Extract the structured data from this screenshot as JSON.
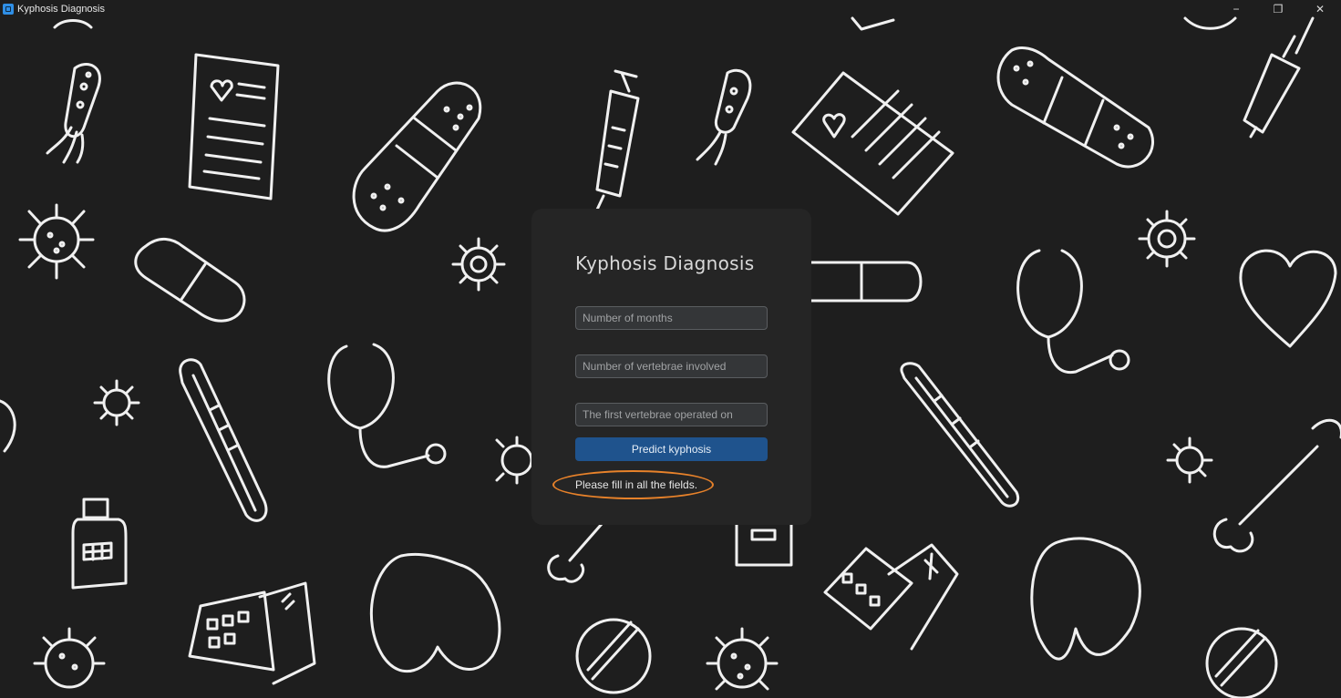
{
  "window": {
    "title": "Kyphosis Diagnosis",
    "controls": {
      "minimize": "−",
      "maximize": "❐",
      "close": "✕"
    }
  },
  "background": {
    "color": "#1e1e1e",
    "pattern": "medical-doodles",
    "stroke_color": "#f0f0f0"
  },
  "form": {
    "title": "Kyphosis Diagnosis",
    "fields": [
      {
        "placeholder": "Number of months",
        "value": ""
      },
      {
        "placeholder": "Number of vertebrae involved",
        "value": ""
      },
      {
        "placeholder": "The first vertebrae operated on",
        "value": ""
      }
    ],
    "submit_label": "Predict kyphosis",
    "message": "Please fill in all the fields."
  },
  "colors": {
    "button": "#1f538d",
    "card": "#252525",
    "highlight": "#e8822a"
  },
  "icons": {
    "app": "app-icon",
    "minimize": "minimize-icon",
    "maximize": "maximize-icon",
    "close": "close-icon"
  }
}
